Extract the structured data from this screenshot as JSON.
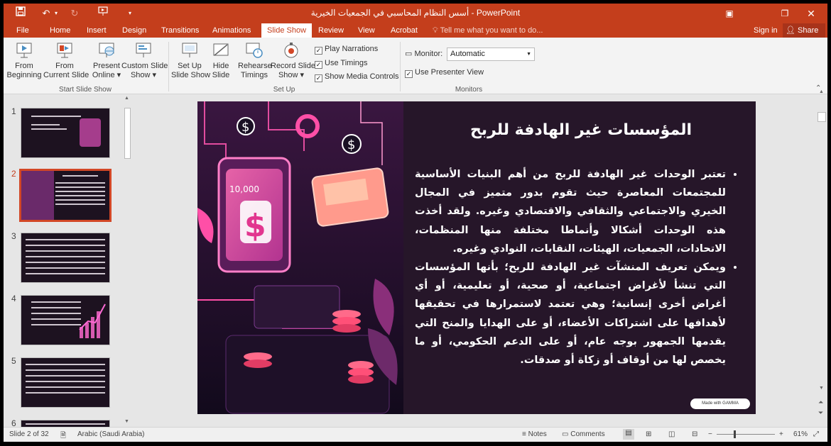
{
  "titlebar": {
    "title": "أسس النظام المحاسبي في الجمعيات الخيرية  -  PowerPoint",
    "icons": [
      "save-icon",
      "undo-icon",
      "redo-icon",
      "start-from-beginning-icon",
      "customize-qat-icon"
    ],
    "window_controls": [
      "ribbon-display-icon",
      "restore-down-icon",
      "close-icon"
    ]
  },
  "tabs": [
    {
      "label": "File"
    },
    {
      "label": "Home"
    },
    {
      "label": "Insert"
    },
    {
      "label": "Design"
    },
    {
      "label": "Transitions"
    },
    {
      "label": "Animations"
    },
    {
      "label": "Slide Show",
      "active": true
    },
    {
      "label": "Review"
    },
    {
      "label": "View"
    },
    {
      "label": "Acrobat"
    }
  ],
  "tell_me": "Tell me what you want to do...",
  "sign_in": "Sign in",
  "share": "Share",
  "ribbon": {
    "start_group": {
      "label": "Start Slide Show",
      "from_beginning": "From\nBeginning",
      "from_current": "From\nCurrent Slide",
      "present_online": "Present\nOnline ▾",
      "custom_show": "Custom Slide\nShow ▾"
    },
    "setup_group": {
      "label": "Set Up",
      "setup_show": "Set Up\nSlide Show",
      "hide_slide": "Hide\nSlide",
      "rehearse": "Rehearse\nTimings",
      "record": "Record Slide\nShow ▾",
      "play_narrations": "Play Narrations",
      "use_timings": "Use Timings",
      "show_media_controls": "Show Media Controls"
    },
    "monitors_group": {
      "label": "Monitors",
      "monitor_label": "Monitor:",
      "monitor_value": "Automatic",
      "presenter_view": "Use Presenter View"
    }
  },
  "thumbnails": [
    {
      "num": "1"
    },
    {
      "num": "2",
      "selected": true
    },
    {
      "num": "3"
    },
    {
      "num": "4"
    },
    {
      "num": "5"
    },
    {
      "num": "6"
    }
  ],
  "slide": {
    "title": "المؤسسات غير الهادفة للربح",
    "bullets": [
      "تعتبر الوحدات غير الهادفة للربح من أهم البنيات الأساسية للمجتمعات المعاصرة حيث تقوم بدور متميز في المجال الخيري والاجتماعي والثقافي والاقتصادي وغيره. ولقد أخذت هذه الوحدات أشكالا وأنماطا مختلفة منها المنظمات، الاتحادات، الجمعيات، الهيئات، النقابات، النوادي وغيره.",
      "ويمكن تعريف المنشآت غير الهادفة للربح؛ بأنها المؤسسات التي تنشأ لأغراض اجتماعية، أو صحية، أو تعليمية، أو أي أغراض أخرى إنسانية؛ وهي تعتمد لاستمرارها في تحقيقها لأهدافها على اشتراكات الأعضاء، أو على الهدايا والمنح التي يقدمها الجمهور بوجه عام، أو على الدعم الحكومي، أو ما يخصص لها من أوقاف أو زكاة أو صدقات."
    ],
    "badge": "Made with GAMMA"
  },
  "status": {
    "slide_info": "Slide 2 of 32",
    "language": "Arabic (Saudi Arabia)",
    "notes": "Notes",
    "comments": "Comments",
    "zoom": "61%",
    "zoom_minus": "−",
    "zoom_plus": "+"
  }
}
